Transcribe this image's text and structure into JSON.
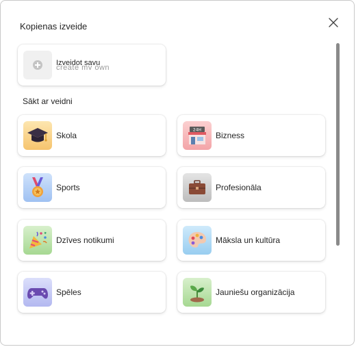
{
  "dialog": {
    "title": "Kopienas izveide",
    "close_icon": "close-icon"
  },
  "create": {
    "label": "Izveidot savu",
    "ghost": "create my own",
    "icon": "plus-icon"
  },
  "section_label": "Sākt ar veidni",
  "templates": [
    {
      "label": "Skola",
      "icon": "graduation-cap-icon",
      "color": "#f9d38a"
    },
    {
      "label": "Bizness",
      "icon": "storefront-icon",
      "color": "#f4a9ab"
    },
    {
      "label": "Sports",
      "icon": "medal-icon",
      "color": "#a9c9f4"
    },
    {
      "label": "Profesionāla",
      "icon": "briefcase-icon",
      "color": "#c8c8c8"
    },
    {
      "label": "Dzīves notikumi",
      "icon": "party-popper-icon",
      "color": "#b8e2a6"
    },
    {
      "label": "Māksla un kultūra",
      "icon": "palette-icon",
      "color": "#a9d8f4"
    },
    {
      "label": "Spēles",
      "icon": "game-controller-icon",
      "color": "#c4c8f4"
    },
    {
      "label": "Jauniešu organizācija",
      "icon": "sprout-icon",
      "color": "#b8e2a6"
    }
  ]
}
